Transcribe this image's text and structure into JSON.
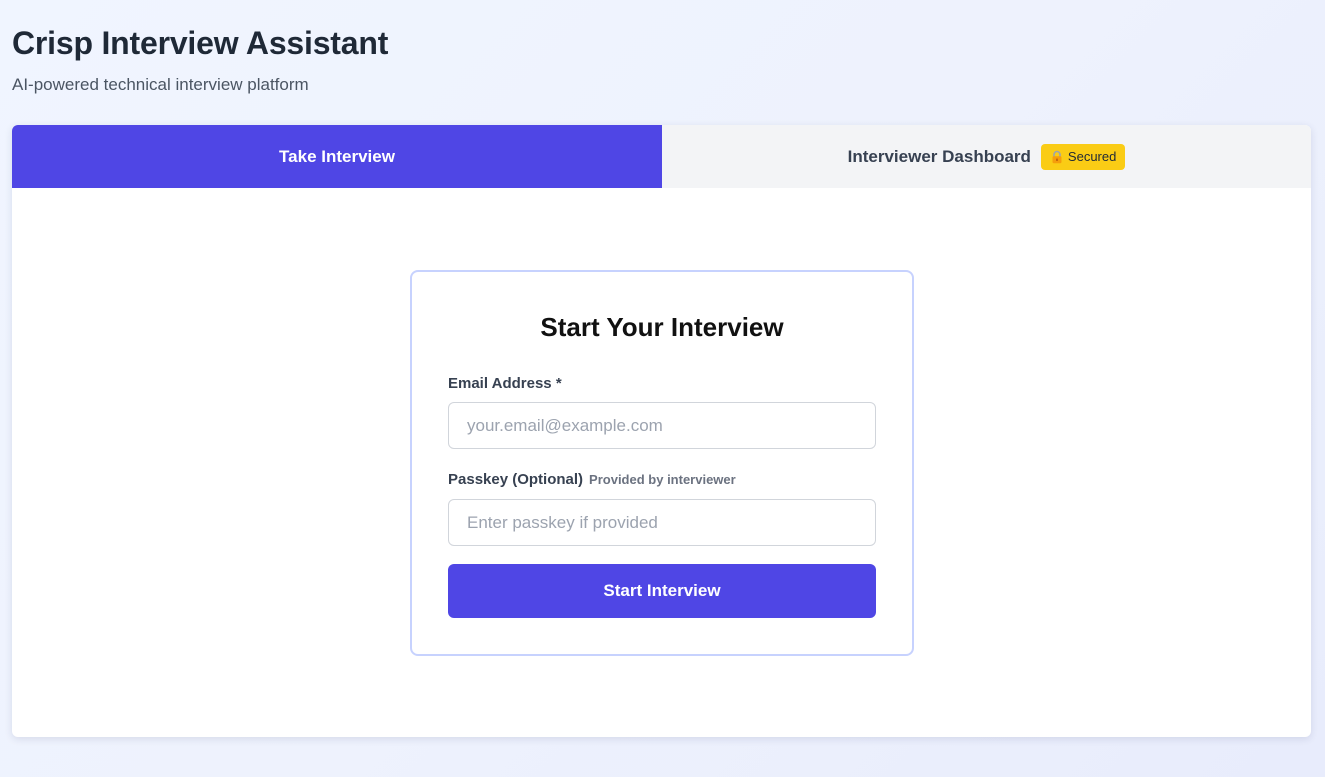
{
  "header": {
    "title": "Crisp Interview Assistant",
    "subtitle": "AI-powered technical interview platform"
  },
  "tabs": [
    {
      "label": "Take Interview",
      "active": true
    },
    {
      "label": "Interviewer Dashboard",
      "active": false,
      "badge": {
        "icon": "lock-icon",
        "label": "Secured"
      }
    }
  ],
  "form": {
    "title": "Start Your Interview",
    "email": {
      "label": "Email Address *",
      "placeholder": "your.email@example.com",
      "value": ""
    },
    "passkey": {
      "label": "Passkey (Optional)",
      "hint": "Provided by interviewer",
      "placeholder": "Enter passkey if provided",
      "value": ""
    },
    "submit_label": "Start Interview"
  },
  "colors": {
    "accent": "#4f46e5",
    "badge": "#facc15",
    "card_border": "#c7d2fe"
  }
}
